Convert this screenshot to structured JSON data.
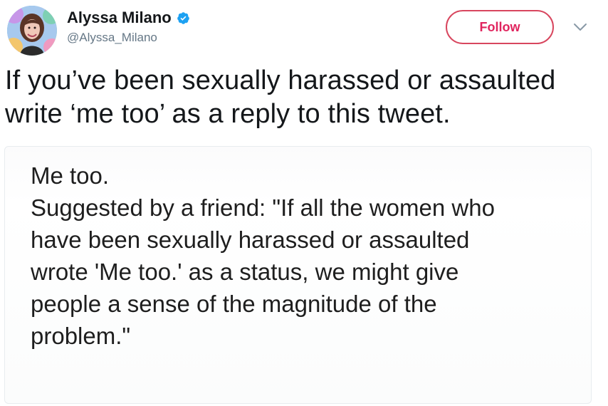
{
  "user": {
    "display_name": "Alyssa Milano",
    "handle": "@Alyssa_Milano",
    "verified": true
  },
  "actions": {
    "follow_label": "Follow"
  },
  "tweet": {
    "lines": [
      "If you’ve been sexually harassed or assaulted",
      "write ‘me too’ as a reply to this tweet."
    ]
  },
  "media": {
    "heading": "Me too.",
    "quote_lines": [
      "Suggested by a friend: \"If all the women who",
      "have been sexually harassed or assaulted",
      "wrote 'Me too.' as a status, we might give",
      "people a sense of the magnitude of the",
      "problem.\""
    ]
  },
  "colors": {
    "follow_accent": "#e0245e",
    "verified_blue": "#1da1f2",
    "handle_gray": "#657786"
  },
  "icons": {
    "verified": "verified-badge-icon",
    "caret": "chevron-down-icon"
  }
}
